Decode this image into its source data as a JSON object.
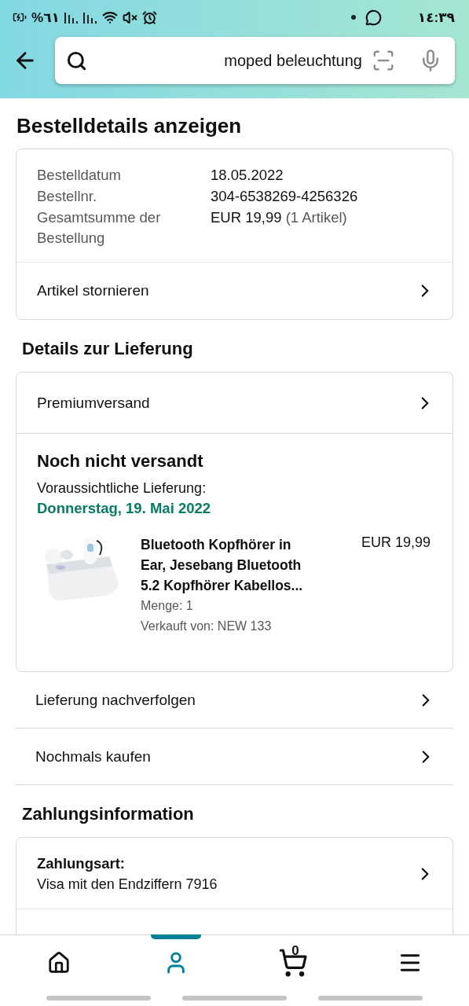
{
  "status_bar": {
    "battery": "%٦١",
    "time": "١٤:٣٩"
  },
  "search": {
    "value": "moped beleuchtung"
  },
  "page_title": "Bestelldetails anzeigen",
  "order_summary": {
    "rows": [
      {
        "label": "Bestelldatum",
        "value": "18.05.2022"
      },
      {
        "label": "Bestellnr.",
        "value": "304-6538269-4256326"
      },
      {
        "label": "Gesamtsumme der Bestellung",
        "value": "EUR 19,99",
        "note": "(1 Artikel)"
      }
    ],
    "action": "Artikel stornieren"
  },
  "delivery": {
    "heading": "Details zur Lieferung",
    "shipping": "Premiumversand",
    "status": "Noch nicht versandt",
    "estimate_label": "Voraussichtliche Lieferung:",
    "estimate_date": "Donnerstag, 19. Mai 2022",
    "items": [
      {
        "title": "Bluetooth Kopfhörer in Ear, Jesebang Bluetooth 5.2 Kopfhörer Kabellos...",
        "price": "EUR 19,99",
        "quantity": "Menge: 1",
        "seller": "Verkauft von: NEW 133"
      }
    ],
    "actions": [
      "Lieferung nachverfolgen",
      "Nochmals kaufen"
    ]
  },
  "payment": {
    "heading": "Zahlungsinformation",
    "method_label": "Zahlungsart:",
    "method_value": "Visa mit den Endziffern 7916"
  },
  "bottom_nav": [
    {
      "kind": "home",
      "selected": false
    },
    {
      "kind": "account",
      "selected": true
    },
    {
      "kind": "cart",
      "selected": false,
      "count": "0"
    },
    {
      "kind": "menu",
      "selected": false
    }
  ]
}
